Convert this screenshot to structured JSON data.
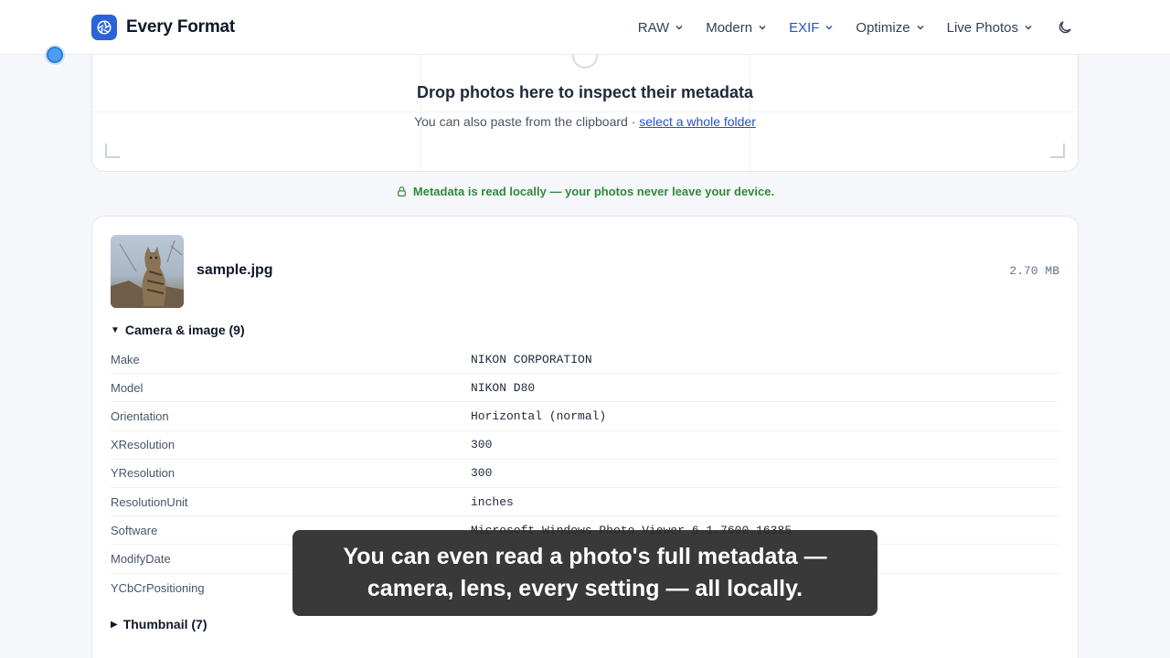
{
  "header": {
    "brand_name": "Every Format",
    "nav": [
      {
        "label": "RAW"
      },
      {
        "label": "Modern"
      },
      {
        "label": "EXIF"
      },
      {
        "label": "Optimize"
      },
      {
        "label": "Live Photos"
      }
    ],
    "active_nav": "EXIF",
    "theme_icon": "moon-icon"
  },
  "dropzone": {
    "title": "Drop photos here to inspect their metadata",
    "subtitle_prefix": "You can also paste from the clipboard ·",
    "folder_link": "select a whole folder"
  },
  "privacy_note": "Metadata is read locally — your photos never leave your device.",
  "file": {
    "name": "sample.jpg",
    "size": "2.70 MB",
    "sections": [
      {
        "title": "Camera & image (9)",
        "expanded": true,
        "rows": [
          {
            "key": "Make",
            "value": "NIKON CORPORATION"
          },
          {
            "key": "Model",
            "value": "NIKON D80"
          },
          {
            "key": "Orientation",
            "value": "Horizontal (normal)"
          },
          {
            "key": "XResolution",
            "value": "300"
          },
          {
            "key": "YResolution",
            "value": "300"
          },
          {
            "key": "ResolutionUnit",
            "value": "inches"
          },
          {
            "key": "Software",
            "value": "Microsoft Windows Photo Viewer 6.1.7600.16385"
          },
          {
            "key": "ModifyDate",
            "value": ""
          },
          {
            "key": "YCbCrPositioning",
            "value": ""
          }
        ]
      },
      {
        "title": "Thumbnail (7)",
        "expanded": false
      }
    ]
  },
  "caption": {
    "line1": "You can even read a photo's full metadata —",
    "line2": "camera, lens, every setting — all locally."
  },
  "colors": {
    "accent": "#2b63d9",
    "link": "#2b4fc9",
    "privacy_green": "#2f8a3a"
  }
}
